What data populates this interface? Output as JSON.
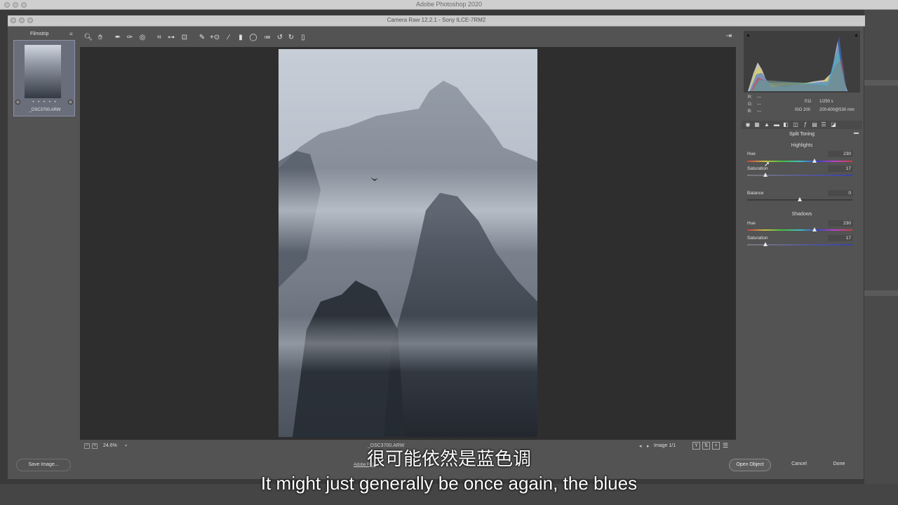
{
  "app": {
    "title": "Adobe Photoshop 2020"
  },
  "dialog": {
    "title": "Camera Raw 12.2.1  -  Sony ILCE-7RM2"
  },
  "filmstrip": {
    "label": "Filmstrip",
    "menu_glyph": "≡",
    "items": [
      {
        "name": "_DSC3700.ARW",
        "stars": "• • • • •"
      }
    ]
  },
  "toolbar": {
    "tools": [
      "zoom-icon",
      "hand-icon",
      "white-balance-icon",
      "color-sampler-icon",
      "targeted-adjustment-icon",
      "crop-icon",
      "straighten-icon",
      "transform-icon",
      "spot-removal-icon",
      "red-eye-icon",
      "adjustment-brush-icon",
      "graduated-filter-icon",
      "radial-filter-icon",
      "presets-icon",
      "rotate-left-icon",
      "rotate-right-icon"
    ],
    "open_full_glyph": "⇥"
  },
  "status": {
    "zoom": "24.6%",
    "filename": "_DSC3700.ARW",
    "image_count": "Image 1/1"
  },
  "footer": {
    "save_label": "Save Image...",
    "workflow_link": "Adobe RGB",
    "open_label": "Open Object",
    "cancel_label": "Cancel",
    "done_label": "Done"
  },
  "info": {
    "r_label": "R:",
    "r_value": "---",
    "g_label": "G:",
    "g_value": "---",
    "b_label": "B:",
    "b_value": "---",
    "aperture": "f/11",
    "shutter": "1/250 s",
    "iso": "ISO 200",
    "lens": "200-600@530 mm"
  },
  "panel": {
    "title": "Split Toning",
    "highlights": {
      "heading": "Highlights",
      "hue_label": "Hue",
      "hue_value": "230",
      "hue_pos": 0.64,
      "sat_label": "Saturation",
      "sat_value": "17",
      "sat_pos": 0.17
    },
    "balance": {
      "label": "Balance",
      "value": "0",
      "pos": 0.5
    },
    "shadows": {
      "heading": "Shadows",
      "hue_label": "Hue",
      "hue_value": "230",
      "hue_pos": 0.64,
      "sat_label": "Saturation",
      "sat_value": "17",
      "sat_pos": 0.17
    }
  },
  "subtitles": {
    "cn": "很可能依然是蓝色调",
    "en": "It might just generally be once again, the blues"
  },
  "colors": {
    "accent": "#8a90a8",
    "dialog_bg": "#535353",
    "preview_bg": "#2e2e2e"
  }
}
